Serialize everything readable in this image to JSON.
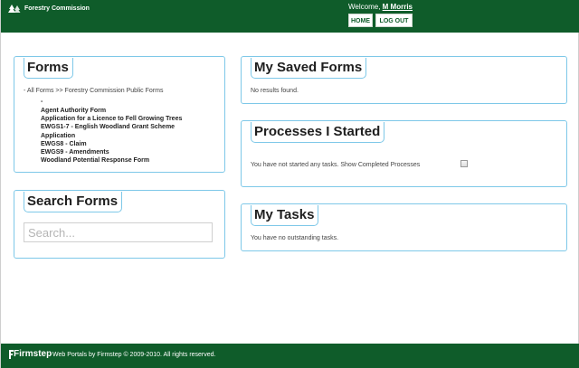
{
  "header": {
    "logo_text": "Forestry Commission",
    "welcome_prefix": "Welcome,",
    "user_name": "M Morris",
    "home_label": "HOME",
    "logout_label": "LOG OUT",
    "brand_color": "#0f5c2a"
  },
  "forms_panel": {
    "title": "Forms",
    "breadcrumb_all": "- All Forms",
    "breadcrumb_sep": ">>",
    "breadcrumb_current": "Forestry Commission Public Forms",
    "items": [
      "-",
      "Agent Authority Form",
      "Application for a Licence to Fell Growing Trees",
      "EWGS1-7 - English Woodland Grant Scheme",
      "Application",
      "EWGS8 - Claim",
      "EWGS9 - Amendments",
      "Woodland Potential Response Form"
    ]
  },
  "search_panel": {
    "title": "Search Forms",
    "placeholder": "Search..."
  },
  "saved_panel": {
    "title": "My Saved Forms",
    "message": "No results found."
  },
  "processes_panel": {
    "title": "Processes I Started",
    "message": "You have not started any tasks.",
    "show_completed_label": "Show Completed Processes",
    "show_completed_checked": false
  },
  "tasks_panel": {
    "title": "My Tasks",
    "message": "You have no outstanding tasks."
  },
  "footer": {
    "logo_text": "Firmstep",
    "copyright": "Web Portals by Firmstep © 2009-2010. All rights reserved."
  },
  "icons": {
    "header_logo": "tree-logo-icon",
    "footer_logo": "firmstep-logo-icon",
    "checkbox": "checkbox-icon"
  }
}
